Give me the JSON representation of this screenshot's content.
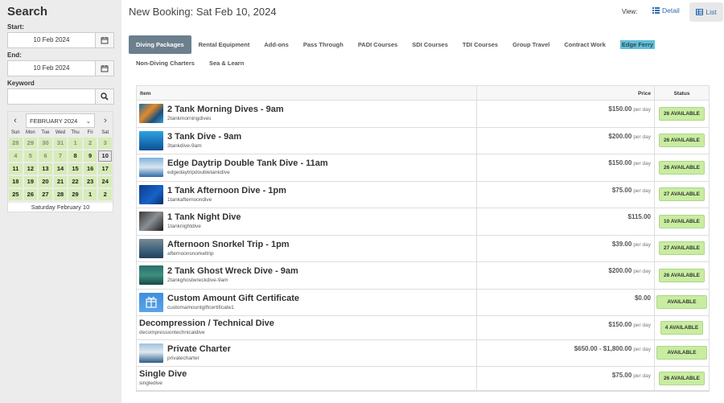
{
  "sidebar": {
    "title": "Search",
    "start_label": "Start:",
    "start_value": "10 Feb 2024",
    "end_label": "End:",
    "end_value": "10 Feb 2024",
    "keyword_label": "Keyword",
    "keyword_value": ""
  },
  "calendar": {
    "prev_icon": "chevron-left-icon",
    "next_icon": "chevron-right-icon",
    "month": "FEBRUARY 2024",
    "weekdays": [
      "Sun",
      "Mon",
      "Tue",
      "Wed",
      "Thu",
      "Fri",
      "Sat"
    ],
    "days": [
      {
        "d": "28",
        "in": false
      },
      {
        "d": "29",
        "in": false
      },
      {
        "d": "30",
        "in": false
      },
      {
        "d": "31",
        "in": false
      },
      {
        "d": "1",
        "in": false
      },
      {
        "d": "2",
        "in": false
      },
      {
        "d": "3",
        "in": false
      },
      {
        "d": "4",
        "in": false
      },
      {
        "d": "5",
        "in": false
      },
      {
        "d": "6",
        "in": false
      },
      {
        "d": "7",
        "in": false
      },
      {
        "d": "8",
        "in": true
      },
      {
        "d": "9",
        "in": true
      },
      {
        "d": "10",
        "in": true,
        "selected": true
      },
      {
        "d": "11",
        "in": true
      },
      {
        "d": "12",
        "in": true
      },
      {
        "d": "13",
        "in": true
      },
      {
        "d": "14",
        "in": true
      },
      {
        "d": "15",
        "in": true
      },
      {
        "d": "16",
        "in": true
      },
      {
        "d": "17",
        "in": true
      },
      {
        "d": "18",
        "in": true
      },
      {
        "d": "19",
        "in": true
      },
      {
        "d": "20",
        "in": true
      },
      {
        "d": "21",
        "in": true
      },
      {
        "d": "22",
        "in": true
      },
      {
        "d": "23",
        "in": true
      },
      {
        "d": "24",
        "in": true
      },
      {
        "d": "25",
        "in": true
      },
      {
        "d": "26",
        "in": true
      },
      {
        "d": "27",
        "in": true
      },
      {
        "d": "28",
        "in": true
      },
      {
        "d": "29",
        "in": true
      },
      {
        "d": "1",
        "in": true
      },
      {
        "d": "2",
        "in": true
      }
    ],
    "selected_label": "Saturday February 10",
    "day_color": "#d7ecb7"
  },
  "header": {
    "title": "New Booking: Sat Feb 10, 2024",
    "view_label": "View:",
    "detail_label": "Detail",
    "list_label": "List"
  },
  "tabs": [
    {
      "label": "Diving Packages",
      "active": true
    },
    {
      "label": "Rental Equipment"
    },
    {
      "label": "Add-ons"
    },
    {
      "label": "Pass Through"
    },
    {
      "label": "PADI Courses"
    },
    {
      "label": "SDI Courses"
    },
    {
      "label": "TDI Courses"
    },
    {
      "label": "Group Travel"
    },
    {
      "label": "Contract Work"
    },
    {
      "label": "Edge Ferry",
      "highlight": true
    },
    {
      "label": "Non-Diving Charters"
    },
    {
      "label": "Sea & Learn"
    }
  ],
  "table": {
    "col_item": "Item",
    "col_price": "Price",
    "col_status": "Status",
    "rows": [
      {
        "name": "2 Tank Morning Dives - 9am",
        "code": "2tankmorningdives",
        "price": "$150.00",
        "per_day": "per day",
        "status": "26 AVAILABLE",
        "thumb": "coral"
      },
      {
        "name": "3 Tank Dive - 9am",
        "code": "3tankdive-9am",
        "price": "$200.00",
        "per_day": "per day",
        "status": "26 AVAILABLE",
        "thumb": "ocean"
      },
      {
        "name": "Edge Daytrip Double Tank Dive - 11am",
        "code": "edgedaytripdoubletankdive",
        "price": "$150.00",
        "per_day": "per day",
        "status": "26 AVAILABLE",
        "thumb": "boat"
      },
      {
        "name": "1 Tank Afternoon Dive - 1pm",
        "code": "1tankafternoondive",
        "price": "$75.00",
        "per_day": "per day",
        "status": "27 AVAILABLE",
        "thumb": "diver"
      },
      {
        "name": "1 Tank Night Dive",
        "code": "1tanknightdive",
        "price": "$115.00",
        "per_day": "",
        "status": "10 AVAILABLE",
        "thumb": "night"
      },
      {
        "name": "Afternoon Snorkel Trip - 1pm",
        "code": "afternoonsnorkeltrip",
        "price": "$39.00",
        "per_day": "per day",
        "status": "27 AVAILABLE",
        "thumb": "snorkel"
      },
      {
        "name": "2 Tank Ghost Wreck Dive - 9am",
        "code": "2tankghostwreckdive-9am",
        "price": "$200.00",
        "per_day": "per day",
        "status": "26 AVAILABLE",
        "thumb": "wreck"
      },
      {
        "name": "Custom Amount Gift Certificate",
        "code": "customamountgiftcertificate1",
        "price": "$0.00",
        "per_day": "",
        "status": "AVAILABLE",
        "thumb": "gift"
      },
      {
        "name": "Decompression / Technical Dive",
        "code": "decompressiontechnicaldive",
        "price": "$150.00",
        "per_day": "per day",
        "status": "4 AVAILABLE",
        "thumb": ""
      },
      {
        "name": "Private Charter",
        "code": "privatecharter",
        "price": "$650.00 - $1,800.00",
        "per_day": "per day",
        "status": "AVAILABLE",
        "thumb": "charter"
      },
      {
        "name": "Single Dive",
        "code": "singledive",
        "price": "$75.00",
        "per_day": "per day",
        "status": "26 AVAILABLE",
        "thumb": ""
      }
    ]
  },
  "colors": {
    "active_tab": "#6c7f8d",
    "badge": "#c8eda0",
    "highlight_tab": "#5bc0de",
    "link": "#2b6cb0"
  }
}
